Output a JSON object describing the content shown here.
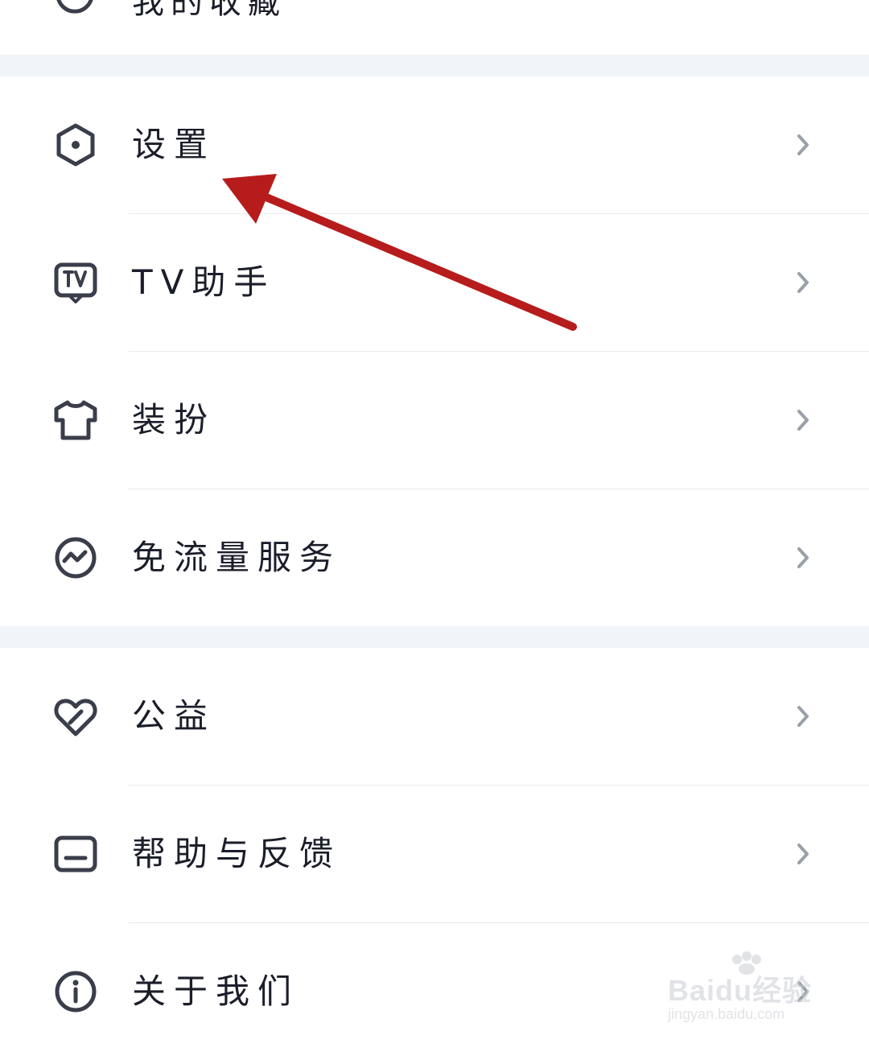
{
  "top_partial": {
    "label": "我的收藏"
  },
  "section1": [
    {
      "label": "设置",
      "icon": "settings-hexagon-icon"
    },
    {
      "label": "TV助手",
      "icon": "tv-icon"
    },
    {
      "label": "装扮",
      "icon": "tshirt-icon"
    },
    {
      "label": "免流量服务",
      "icon": "data-wave-icon"
    }
  ],
  "section2": [
    {
      "label": "公益",
      "icon": "charity-heart-icon"
    },
    {
      "label": "帮助与反馈",
      "icon": "feedback-message-icon"
    },
    {
      "label": "关于我们",
      "icon": "info-icon"
    }
  ],
  "watermark": {
    "brand": "Baidu经验",
    "url": "jingyan.baidu.com"
  },
  "colors": {
    "icon": "#3a3d4a",
    "chevron": "#9aa0aa",
    "divider": "#e9ebef",
    "section_gap": "#f1f4f8",
    "annotation": "#b71c1c"
  }
}
